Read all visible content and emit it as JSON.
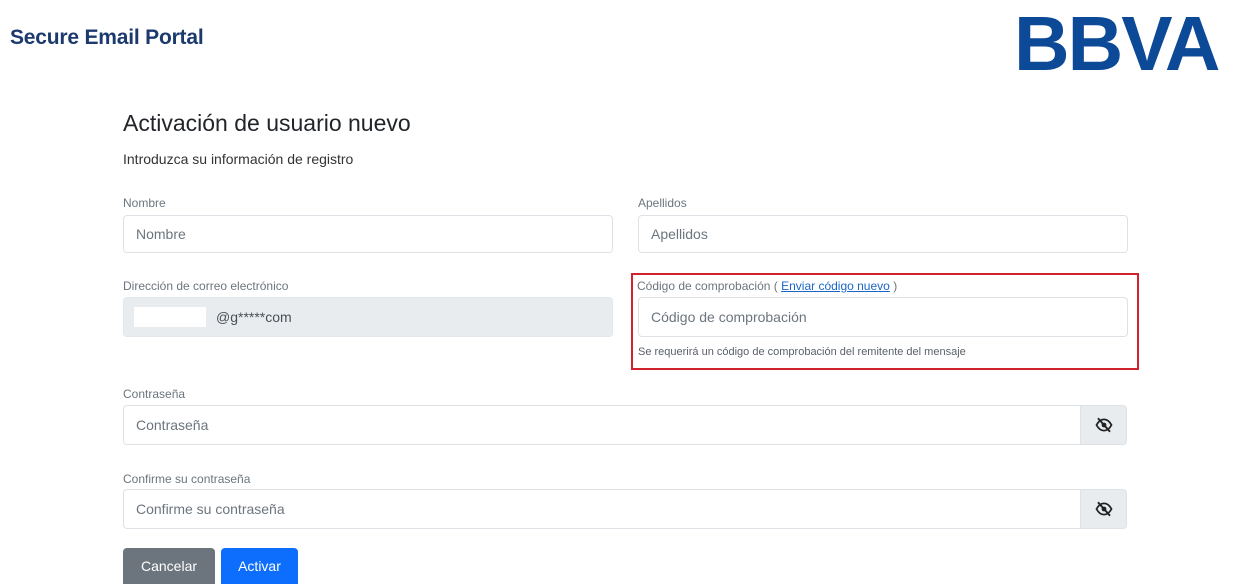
{
  "header": {
    "portal_title": "Secure Email Portal",
    "logo_text": "BBVA",
    "logo_color": "#0c4a98"
  },
  "page": {
    "title": "Activación de usuario nuevo",
    "subtitle": "Introduzca su información de registro"
  },
  "form": {
    "first_name": {
      "label": "Nombre",
      "placeholder": "Nombre"
    },
    "last_name": {
      "label": "Apellidos",
      "placeholder": "Apellidos"
    },
    "email": {
      "label": "Dirección de correo electrónico",
      "value": "@g*****com"
    },
    "verification": {
      "label_prefix": "Código de comprobación (",
      "link": "Enviar código nuevo",
      "label_suffix": ")",
      "placeholder": "Código de comprobación",
      "help": "Se requerirá un código de comprobación del remitente del mensaje",
      "highlight_color": "#d0232e"
    },
    "password": {
      "label": "Contraseña",
      "placeholder": "Contraseña",
      "toggle_icon": "eye-slash-icon"
    },
    "confirm_password": {
      "label": "Confirme su contraseña",
      "placeholder": "Confirme su contraseña",
      "toggle_icon": "eye-slash-icon"
    }
  },
  "actions": {
    "cancel_label": "Cancelar",
    "activate_label": "Activar",
    "cancel_color": "#6c757d",
    "activate_color": "#0d6efd"
  }
}
